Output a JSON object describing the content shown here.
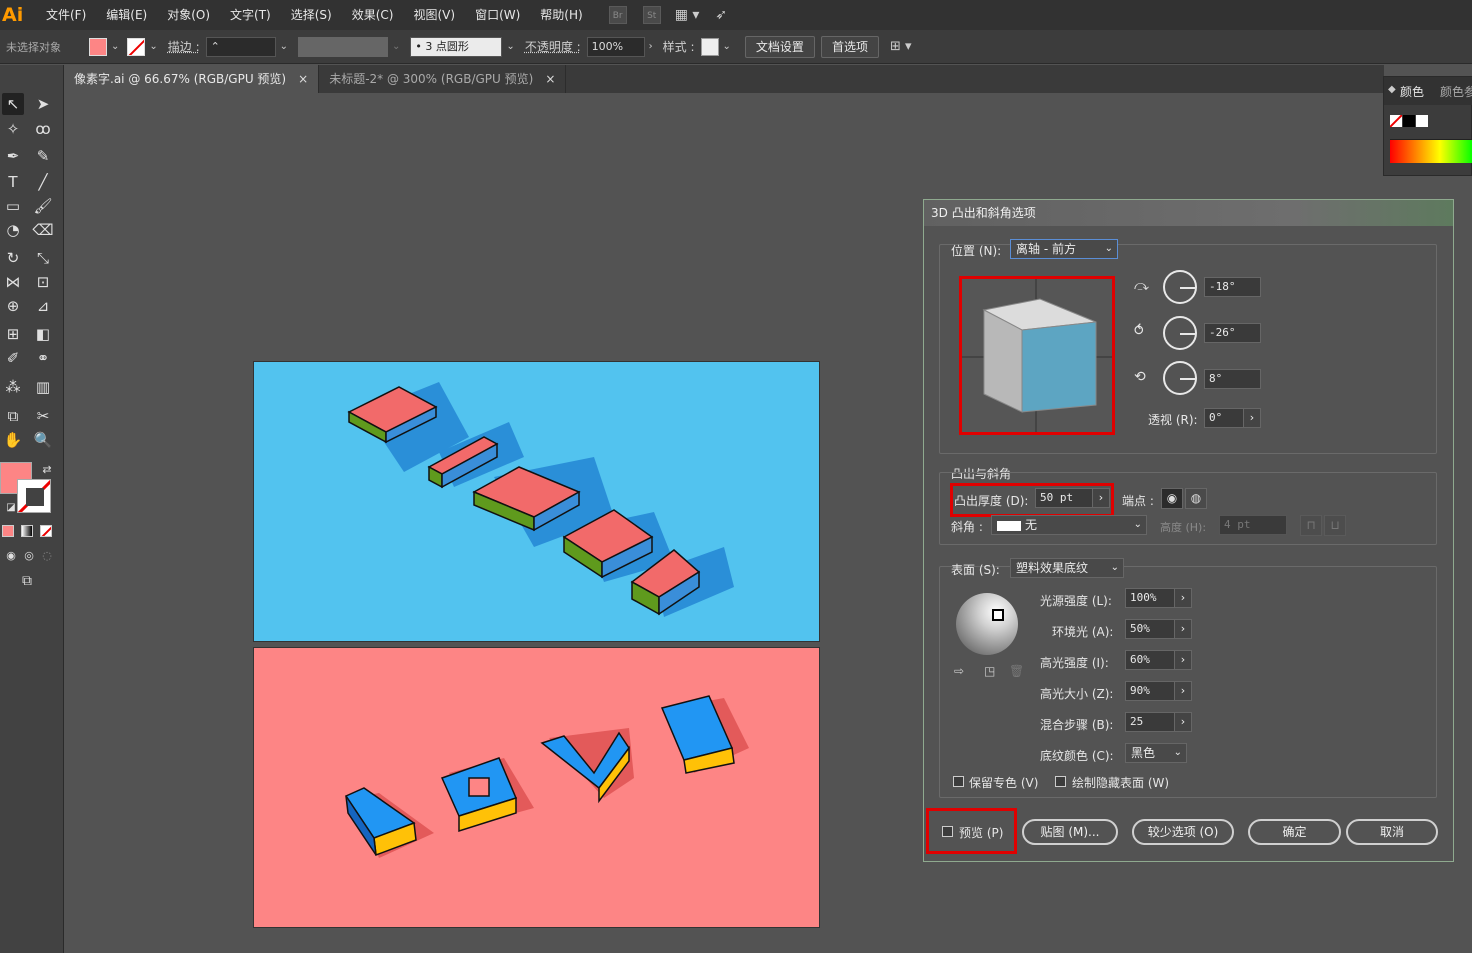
{
  "app": {
    "logo": "Ai"
  },
  "menu": [
    "文件(F)",
    "编辑(E)",
    "对象(O)",
    "文字(T)",
    "选择(S)",
    "效果(C)",
    "视图(V)",
    "窗口(W)",
    "帮助(H)"
  ],
  "menu_icons": {
    "br": "Br",
    "st": "St"
  },
  "control": {
    "no_selection": "未选择对象",
    "stroke_label": "描边 :",
    "brush_value": "3 点圆形",
    "opacity_label": "不透明度 :",
    "opacity_value": "100%",
    "style_label": "样式 :",
    "doc_setup": "文档设置",
    "preferences": "首选项"
  },
  "tabs": [
    {
      "label": "像素字.ai @ 66.67% (RGB/GPU 预览)",
      "close": "×"
    },
    {
      "label": "未标题-2* @ 300% (RGB/GPU 预览)",
      "close": "×"
    }
  ],
  "color_panel": {
    "tab1": "颜色",
    "tab2": "颜色参"
  },
  "dialog": {
    "title": "3D 凸出和斜角选项",
    "position_label": "位置 (N):",
    "position_value": "离轴 - 前方",
    "rot_x": "-18°",
    "rot_y": "-26°",
    "rot_z": "8°",
    "perspective_label": "透视 (R):",
    "perspective_value": "0°",
    "extrude_section": "凸出与斜角",
    "extrude_depth_label": "凸出厚度 (D):",
    "extrude_depth_value": "50 pt",
    "cap_label": "端点 :",
    "bevel_label": "斜角 :",
    "bevel_value": "无",
    "height_label": "高度 (H):",
    "height_value": "4 pt",
    "surface_label": "表面 (S):",
    "surface_value": "塑料效果底纹",
    "light_intensity_label": "光源强度 (L):",
    "light_intensity_value": "100%",
    "ambient_label": "环境光 (A):",
    "ambient_value": "50%",
    "highlight_intensity_label": "高光强度 (I):",
    "highlight_intensity_value": "60%",
    "highlight_size_label": "高光大小 (Z):",
    "highlight_size_value": "90%",
    "blend_steps_label": "混合步骤 (B):",
    "blend_steps_value": "25",
    "shading_color_label": "底纹颜色 (C):",
    "shading_color_value": "黑色",
    "preserve_spot_label": "保留专色 (V)",
    "draw_hidden_label": "绘制隐藏表面 (W)",
    "preview_label": "预览 (P)",
    "map_art_button": "贴图 (M)...",
    "fewer_options_button": "较少选项 (O)",
    "ok_button": "确定",
    "cancel_button": "取消"
  },
  "colors": {
    "accent_red": "#e00000",
    "art1_bg": "#52c3ef",
    "art2_bg": "#fd8585"
  }
}
